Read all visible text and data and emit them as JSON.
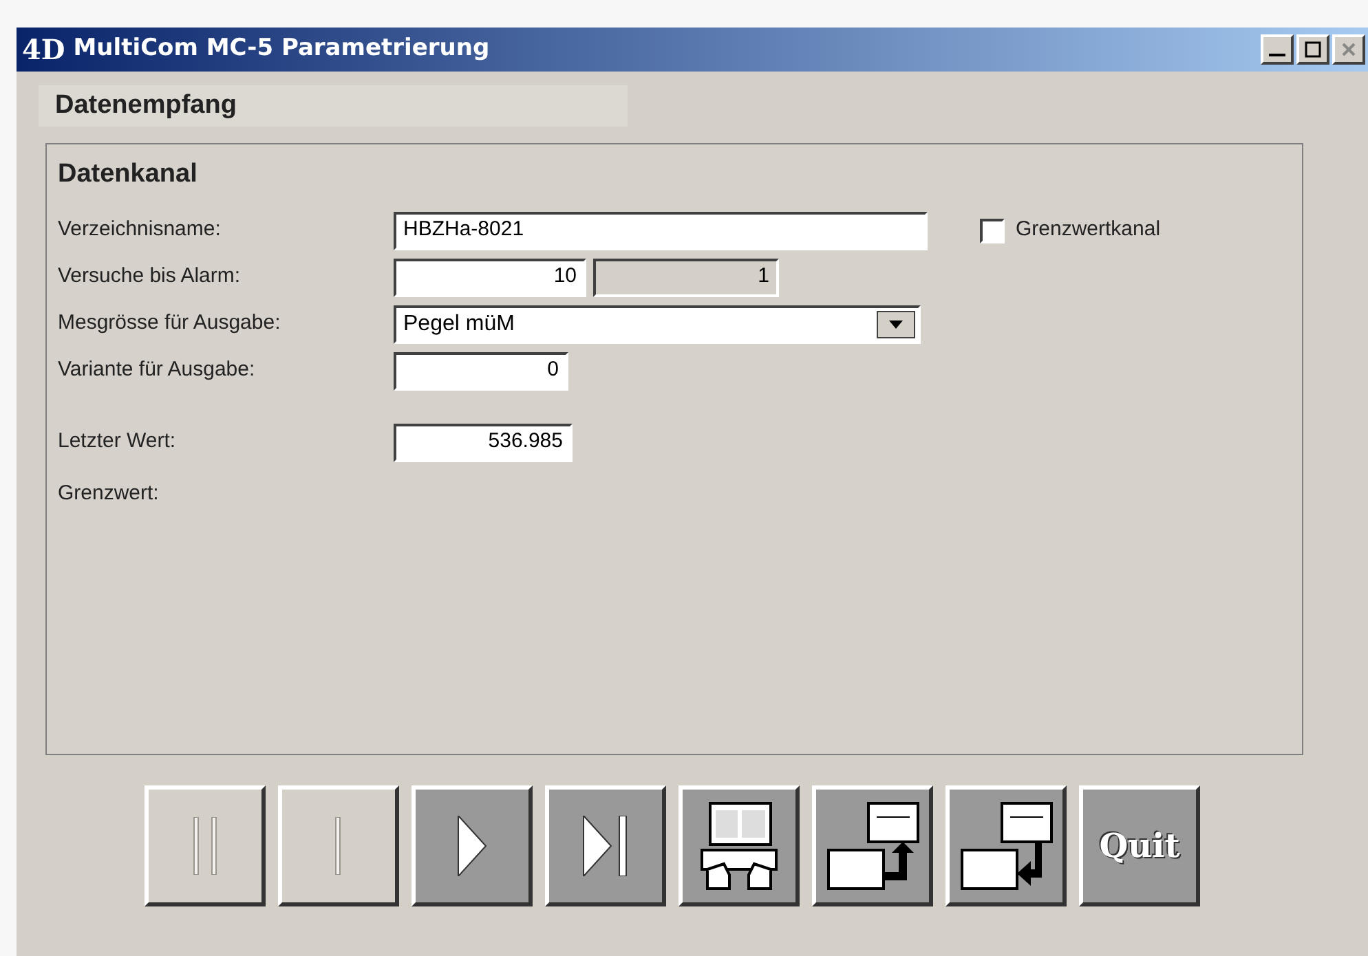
{
  "window": {
    "title": "MultiCom MC-5 Parametrierung",
    "logo": "4D"
  },
  "section": "Datenempfang",
  "group": {
    "title": "Datenkanal",
    "fields": [
      {
        "kind": "text",
        "label": "Verzeichnisname:",
        "value": "HBZHa-8021"
      },
      {
        "kind": "pair",
        "label": "Versuche bis Alarm:",
        "value": "10",
        "value2": "1"
      },
      {
        "kind": "select",
        "label": "Mesgrösse für Ausgabe:",
        "value": "Pegel müM"
      },
      {
        "kind": "number",
        "label": "Variante für Ausgabe:",
        "value": "0"
      },
      {
        "kind": "number",
        "label": "Letzter Wert:",
        "value": "536.985"
      },
      {
        "kind": "label",
        "label": "Grenzwert:"
      }
    ],
    "checkbox": {
      "label": "Grenzwertkanal",
      "checked": false
    }
  },
  "buttons": [
    {
      "kind": "first",
      "disabled": true
    },
    {
      "kind": "prev",
      "disabled": true
    },
    {
      "kind": "next",
      "disabled": false
    },
    {
      "kind": "last",
      "disabled": false
    },
    {
      "kind": "edit",
      "disabled": false
    },
    {
      "kind": "export",
      "disabled": false
    },
    {
      "kind": "import",
      "disabled": false
    },
    {
      "kind": "quit",
      "label": "Quit",
      "disabled": false
    }
  ]
}
